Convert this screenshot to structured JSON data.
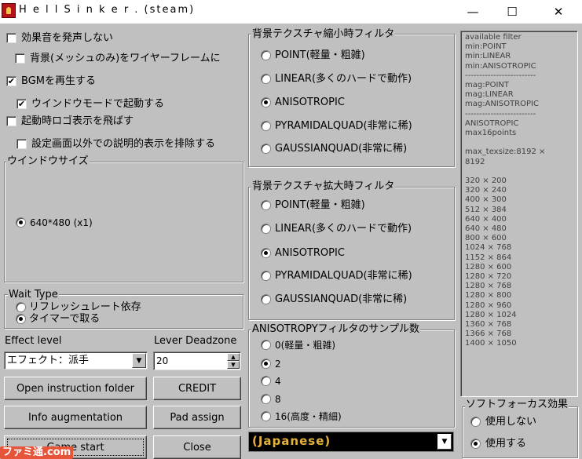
{
  "window": {
    "title": "H e l l S i n k e r . (steam)",
    "min_glyph": "—",
    "max_glyph": "☐",
    "close_glyph": "✕"
  },
  "options": [
    {
      "label": "効果音を発声しない",
      "checked": false
    },
    {
      "label": "背景(メッシュのみ)をワイヤーフレームに",
      "checked": false
    },
    {
      "label": "BGMを再生する",
      "checked": true
    },
    {
      "label": "ウインドウモードで起動する",
      "checked": true
    },
    {
      "label": "起動時ロゴ表示を飛ばす",
      "checked": false
    },
    {
      "label": "設定画面以外での説明的表示を排除する",
      "checked": false
    }
  ],
  "window_size": {
    "title": "ウインドウサイズ",
    "option": "640*480 (x1)"
  },
  "wait_type": {
    "title": "Wait Type",
    "options": [
      "リフレッシュレート依存",
      "タイマーで取る"
    ],
    "selected_index": 1
  },
  "effect_level": {
    "label": "Effect level",
    "value": "エフェクト：派手"
  },
  "lever_deadzone": {
    "label": "Lever Deadzone",
    "value": "20"
  },
  "buttons": {
    "open_folder": "Open instruction folder",
    "credit": "CREDIT",
    "info_aug": "Info augmentation",
    "pad_assign": "Pad assign",
    "game_start": "Game start",
    "close": "Close"
  },
  "min_filter": {
    "title": "背景テクスチャ縮小時フィルタ",
    "options": [
      "POINT(軽量・粗雑)",
      "LINEAR(多くのハードで動作)",
      "ANISOTROPIC",
      "PYRAMIDALQUAD(非常に稀)",
      "GAUSSIANQUAD(非常に稀)"
    ],
    "selected_index": 2
  },
  "mag_filter": {
    "title": "背景テクスチャ拡大時フィルタ",
    "options": [
      "POINT(軽量・粗雑)",
      "LINEAR(多くのハードで動作)",
      "ANISOTROPIC",
      "PYRAMIDALQUAD(非常に稀)",
      "GAUSSIANQUAD(非常に稀)"
    ],
    "selected_index": 2
  },
  "samples": {
    "title": "ANISOTROPYフィルタのサンプル数",
    "options": [
      "0(軽量・粗雑)",
      "2",
      "4",
      "8",
      "16(高度・精細)"
    ],
    "selected_index": 1
  },
  "language": {
    "value": "(Japanese)"
  },
  "soft_focus": {
    "title": "ソフトフォーカス効果",
    "options": [
      "使用しない",
      "使用する"
    ],
    "selected_index": 1
  },
  "info_lines": [
    "available filter",
    "min:POINT",
    "min:LINEAR",
    "min:ANISOTROPIC",
    "-------------------------",
    "mag:POINT",
    "mag:LINEAR",
    "mag:ANISOTROPIC",
    "-------------------------",
    "ANISOTROPIC",
    "max16points",
    "",
    "max_texsize:8192 ×",
    "8192",
    "",
    "320 × 200",
    "320 × 240",
    "400 × 300",
    "512 × 384",
    "640 × 400",
    "640 × 480",
    "800 × 600",
    "1024 × 768",
    "1152 × 864",
    "1280 × 600",
    "1280 × 720",
    "1280 × 768",
    "1280 × 800",
    "1280 × 960",
    "1280 × 1024",
    "1360 × 768",
    "1366 × 768",
    "1400 × 1050"
  ],
  "watermark": "ファミ通.com",
  "colors": {
    "dialog_bg": "#c0c0c0",
    "lang_text": "#e3b23c",
    "title_icon": "#b5121b"
  }
}
